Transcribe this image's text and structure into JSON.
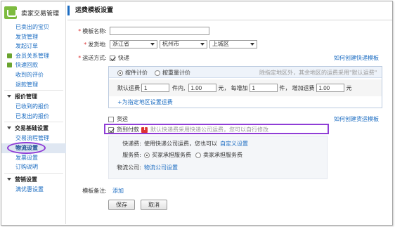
{
  "sidebar": {
    "brand": "卖家交易管理",
    "items": [
      {
        "type": "item",
        "label": "已卖出的宝贝"
      },
      {
        "type": "item",
        "label": "发货管理"
      },
      {
        "type": "item",
        "label": "发起订单"
      },
      {
        "type": "item",
        "label": "会员关系管理",
        "icon": "member-icon"
      },
      {
        "type": "item",
        "label": "快速回款",
        "icon": "payment-icon"
      },
      {
        "type": "item",
        "label": "收到的评价"
      },
      {
        "type": "item",
        "label": "退款管理"
      },
      {
        "type": "group",
        "label": "报价管理"
      },
      {
        "type": "item",
        "label": "已收到的报价"
      },
      {
        "type": "item",
        "label": "已发出的报价"
      },
      {
        "type": "group",
        "label": "交易基础设置"
      },
      {
        "type": "item",
        "label": "交易流程管理"
      },
      {
        "type": "item",
        "label": "物流设置",
        "active": true
      },
      {
        "type": "item",
        "label": "发票设置"
      },
      {
        "type": "item",
        "label": "订购说明"
      },
      {
        "type": "group",
        "label": "营销设置"
      },
      {
        "type": "item",
        "label": "满优惠设置"
      }
    ]
  },
  "main": {
    "title": "运费模板设置",
    "template_name_label": "模板名称:",
    "template_name_value": "",
    "origin_label": "发货地:",
    "origin": {
      "province": "浙江省",
      "city": "杭州市",
      "district": "上城区"
    },
    "shipping_label": "运送方式:",
    "express": {
      "label": "快递",
      "checked": true,
      "help_link": "如何创建快递模板",
      "by_piece": "按件计价",
      "by_weight": "按重量计价",
      "hint": "除指定地区外，其余地区的运费采用\"默认运费\"",
      "default_label": "默认运费",
      "first_count": "1",
      "unit_piece": "件内,",
      "first_fee": "1.00",
      "unit_yuan": "元，",
      "each_add": "每增加",
      "add_count": "1",
      "unit_piece2": "件，",
      "add_fee_label": "增加运费",
      "add_fee": "1.00",
      "unit_yuan2": "元",
      "specify_link": "+为指定地区设置运费"
    },
    "freight": {
      "label": "货运",
      "checked": false,
      "help_link": "如何创建货运模板"
    },
    "cod": {
      "label": "货到付款",
      "checked": true,
      "warning": "默认快递费采用快递公司运费，您可以自行修改",
      "fee_label": "快递费:",
      "fee_text": "使用快递公司运费，您也可以",
      "fee_link": "自定义设置",
      "service_label": "服务费:",
      "service_buyer": "买家承担服务费",
      "service_seller": "卖家承担服务费",
      "company_label": "物流公司:",
      "company_link": "物流公司设置"
    },
    "remark_label": "模板备注:",
    "remark_link": "添加",
    "save": "保存",
    "cancel": "取消"
  },
  "colors": {
    "link": "#1b6cc2",
    "highlight": "#8f3dd6",
    "warning": "#dd3333",
    "brand": "#7dbb3f"
  }
}
